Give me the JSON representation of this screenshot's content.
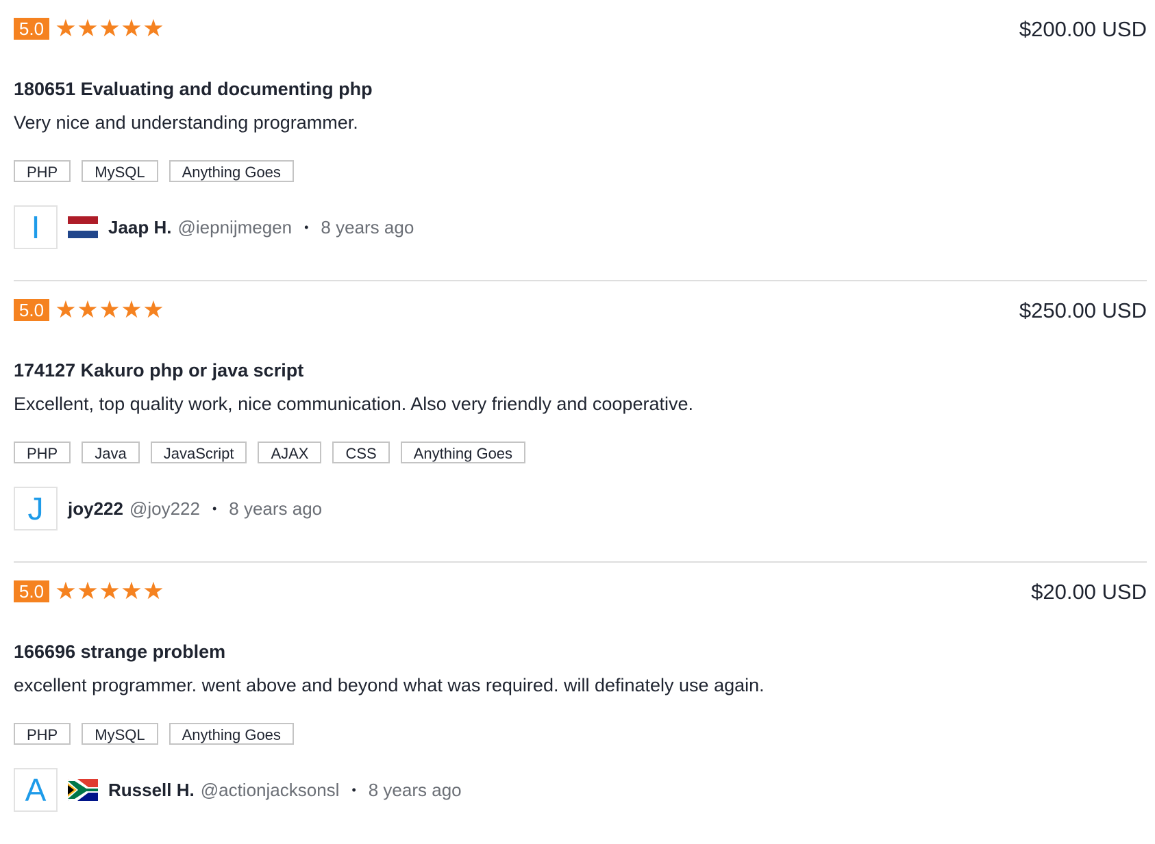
{
  "reviews": [
    {
      "rating": "5.0",
      "stars": 5,
      "price": "$200.00 USD",
      "title": "180651 Evaluating and documenting php",
      "comment": "Very nice and understanding programmer.",
      "tags": [
        "PHP",
        "MySQL",
        "Anything Goes"
      ],
      "avatar_letter": "I",
      "flag": "netherlands-flag-icon",
      "username": "Jaap H.",
      "handle": "@iepnijmegen",
      "time": "8 years ago"
    },
    {
      "rating": "5.0",
      "stars": 5,
      "price": "$250.00 USD",
      "title": "174127 Kakuro php or java script",
      "comment": "Excellent, top quality work, nice communication. Also very friendly and cooperative.",
      "tags": [
        "PHP",
        "Java",
        "JavaScript",
        "AJAX",
        "CSS",
        "Anything Goes"
      ],
      "avatar_letter": "J",
      "flag": "",
      "username": "joy222",
      "handle": "@joy222",
      "time": "8 years ago"
    },
    {
      "rating": "5.0",
      "stars": 5,
      "price": "$20.00 USD",
      "title": "166696 strange problem",
      "comment": "excellent programmer. went above and beyond what was required. will definately use again.",
      "tags": [
        "PHP",
        "MySQL",
        "Anything Goes"
      ],
      "avatar_letter": "A",
      "flag": "south-africa-flag-icon",
      "username": "Russell H.",
      "handle": "@actionjacksonsl",
      "time": "8 years ago"
    }
  ],
  "colors": {
    "accent": "#f58220",
    "avatar_letter": "#1e9be9",
    "muted_text": "#6b6f76"
  }
}
